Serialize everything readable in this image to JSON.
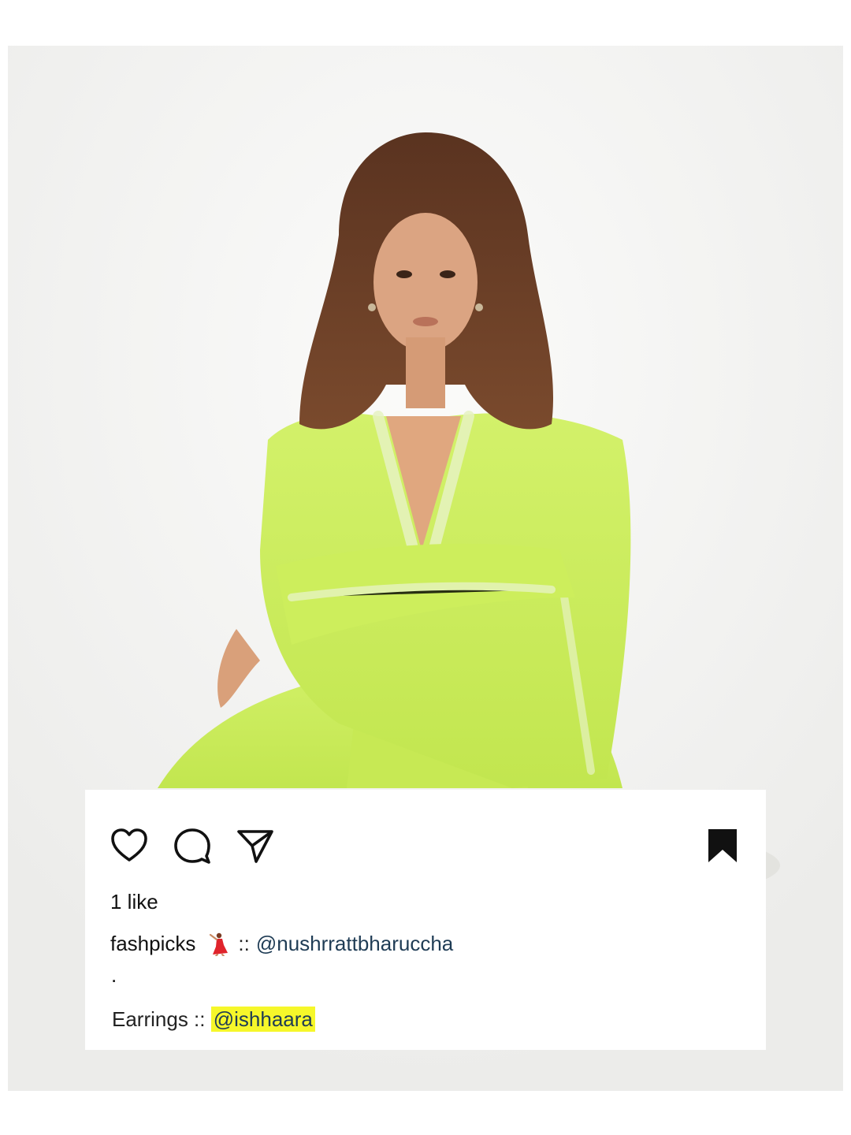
{
  "post": {
    "likes_text": "1 like",
    "caption": {
      "username": "fashpicks",
      "emoji": "💃",
      "separator": "::",
      "mention": "@nushrrattbharuccha"
    },
    "dot": ".",
    "earrings": {
      "label": "Earrings ::",
      "mention": "@ishhaara"
    }
  },
  "icons": {
    "like": "heart-icon",
    "comment": "comment-icon",
    "share": "share-icon",
    "save": "bookmark-icon",
    "caption_emoji": "dancer-icon"
  },
  "colors": {
    "outfit_green": "#c9ec57",
    "mention_blue": "#1f3c55",
    "highlight_yellow": "#f6f72a"
  }
}
